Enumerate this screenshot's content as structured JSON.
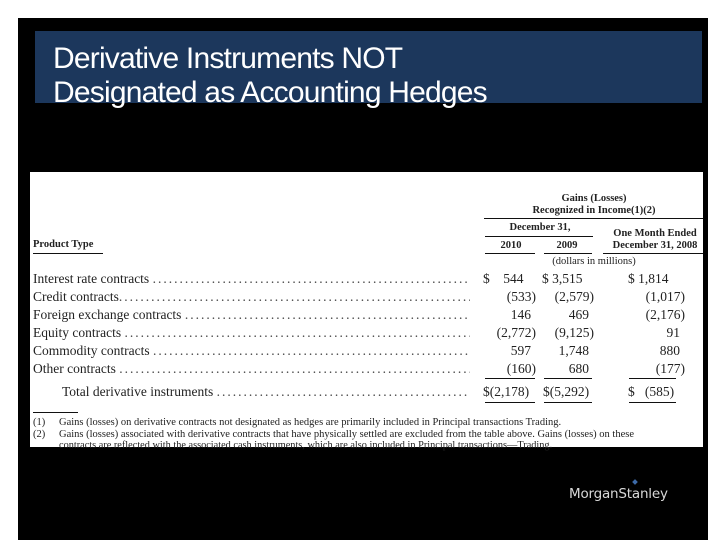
{
  "slide": {
    "title_line1": "Derivative Instruments NOT",
    "title_line2": "Designated as Accounting Hedges",
    "logo_text": "MorganStanley",
    "colors": {
      "title_band": "#1c375c",
      "background": "#000000",
      "document": "#ffffff"
    }
  },
  "table": {
    "header": {
      "group_title_line1": "Gains (Losses)",
      "group_title_line2": "Recognized in Income(1)(2)",
      "period_label": "December 31,",
      "col_2010": "2010",
      "col_2009": "2009",
      "col_2008_line1": "One Month Ended",
      "col_2008_line2": "December 31, 2008",
      "units": "(dollars in millions)",
      "product_type": "Product Type"
    },
    "rows": [
      {
        "label": "Interest rate contracts",
        "v2010": "$    544",
        "v2009": "$ 3,515",
        "v2008": "$ 1,814"
      },
      {
        "label": "Credit contracts",
        "v2010": "(533)",
        "v2009": "(2,579)",
        "v2008": "(1,017)"
      },
      {
        "label": "Foreign exchange contracts",
        "v2010": "146",
        "v2009": "469",
        "v2008": "(2,176)"
      },
      {
        "label": "Equity contracts",
        "v2010": "(2,772)",
        "v2009": "(9,125)",
        "v2008": "91"
      },
      {
        "label": "Commodity contracts",
        "v2010": "597",
        "v2009": "1,748",
        "v2008": "880"
      },
      {
        "label": "Other contracts",
        "v2010": "(160)",
        "v2009": "680",
        "v2008": "(177)"
      }
    ],
    "total": {
      "label": "Total derivative instruments",
      "v2010": "$(2,178)",
      "v2009": "$(5,292)",
      "v2008": "$   (585)"
    },
    "footnotes": [
      {
        "num": "(1)",
        "text": "Gains (losses) on derivative contracts not designated as hedges are primarily included in Principal transactions   Trading."
      },
      {
        "num": "(2)",
        "text": "Gains (losses) associated with derivative contracts that have physically settled are excluded from the table above. Gains (losses) on these"
      },
      {
        "num": "",
        "text": "contracts are reflected with the associated cash instruments, which are also included in Principal transactions—Trading."
      }
    ],
    "leader_dots": "............................................................................................"
  }
}
